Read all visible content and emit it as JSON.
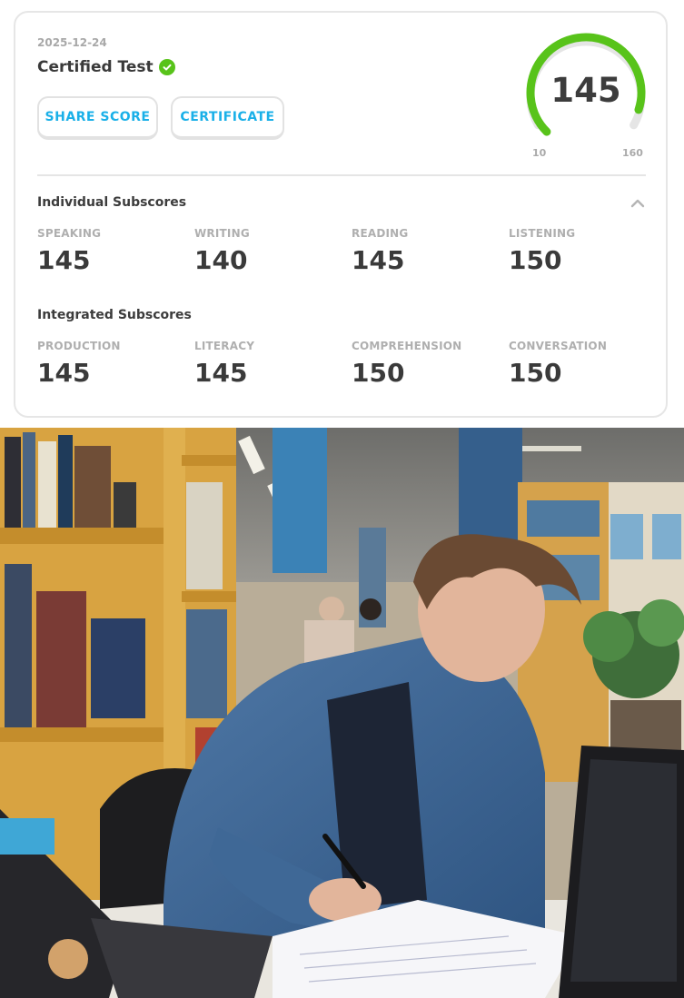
{
  "result": {
    "date": "2025-12-24",
    "title": "Certified Test",
    "share_label": "SHARE SCORE",
    "certificate_label": "CERTIFICATE",
    "score": "145",
    "gauge_min": "10",
    "gauge_max": "160",
    "score_fraction": 0.9
  },
  "individual": {
    "title": "Individual Subscores",
    "items": [
      {
        "label": "SPEAKING",
        "value": "145"
      },
      {
        "label": "WRITING",
        "value": "140"
      },
      {
        "label": "READING",
        "value": "145"
      },
      {
        "label": "LISTENING",
        "value": "150"
      }
    ]
  },
  "integrated": {
    "title": "Integrated Subscores",
    "items": [
      {
        "label": "PRODUCTION",
        "value": "145"
      },
      {
        "label": "LITERACY",
        "value": "145"
      },
      {
        "label": "COMPREHENSION",
        "value": "150"
      },
      {
        "label": "CONVERSATION",
        "value": "150"
      }
    ]
  },
  "colors": {
    "accent_green": "#58c31a",
    "button_blue": "#1ab0e8",
    "track_gray": "#e5e5e5"
  },
  "icons": [
    "check-circle-icon",
    "chevron-up-icon"
  ]
}
